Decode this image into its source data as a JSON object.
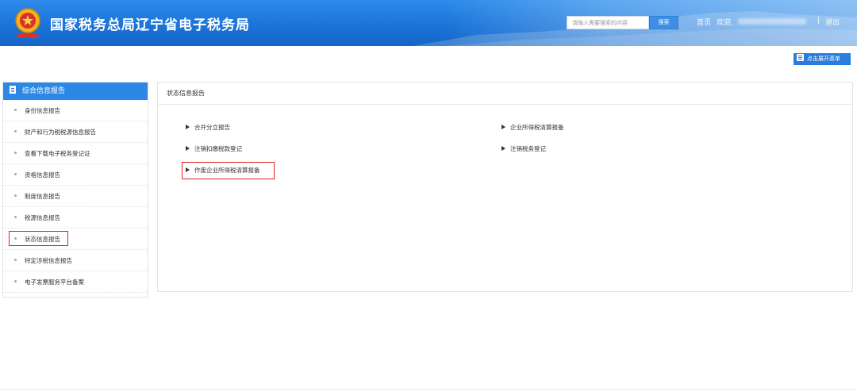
{
  "header": {
    "title": "国家税务总局辽宁省电子税务局",
    "search_placeholder": "请输入需要搜索的内容",
    "search_button": "搜索",
    "nav_home": "首页",
    "nav_welcome": "欢迎,",
    "nav_separator": "|",
    "nav_logout": "退出"
  },
  "toolbar": {
    "menu_toggle_label": "点击展开菜单"
  },
  "sidebar": {
    "heading": "综合信息报告",
    "items": [
      {
        "label": "身份信息报告"
      },
      {
        "label": "财产和行为税税源信息报告"
      },
      {
        "label": "查看下载电子税务登记证"
      },
      {
        "label": "资格信息报告"
      },
      {
        "label": "制度信息报告"
      },
      {
        "label": "税源信息报告"
      },
      {
        "label": "状态信息报告"
      },
      {
        "label": "特定涉税信息报告"
      },
      {
        "label": "电子发票服务平台备案"
      }
    ]
  },
  "main": {
    "title": "状态信息报告",
    "links": [
      {
        "label": "合并分立报告"
      },
      {
        "label": "企业所得税清算报备"
      },
      {
        "label": "注销扣缴税款登记"
      },
      {
        "label": "注销税务登记"
      },
      {
        "label": "作废企业所得税清算报备"
      }
    ]
  },
  "colors": {
    "header_blue": "#1b74d8",
    "sidebar_head_blue": "#2c88e4",
    "highlight_red": "#e02020"
  }
}
